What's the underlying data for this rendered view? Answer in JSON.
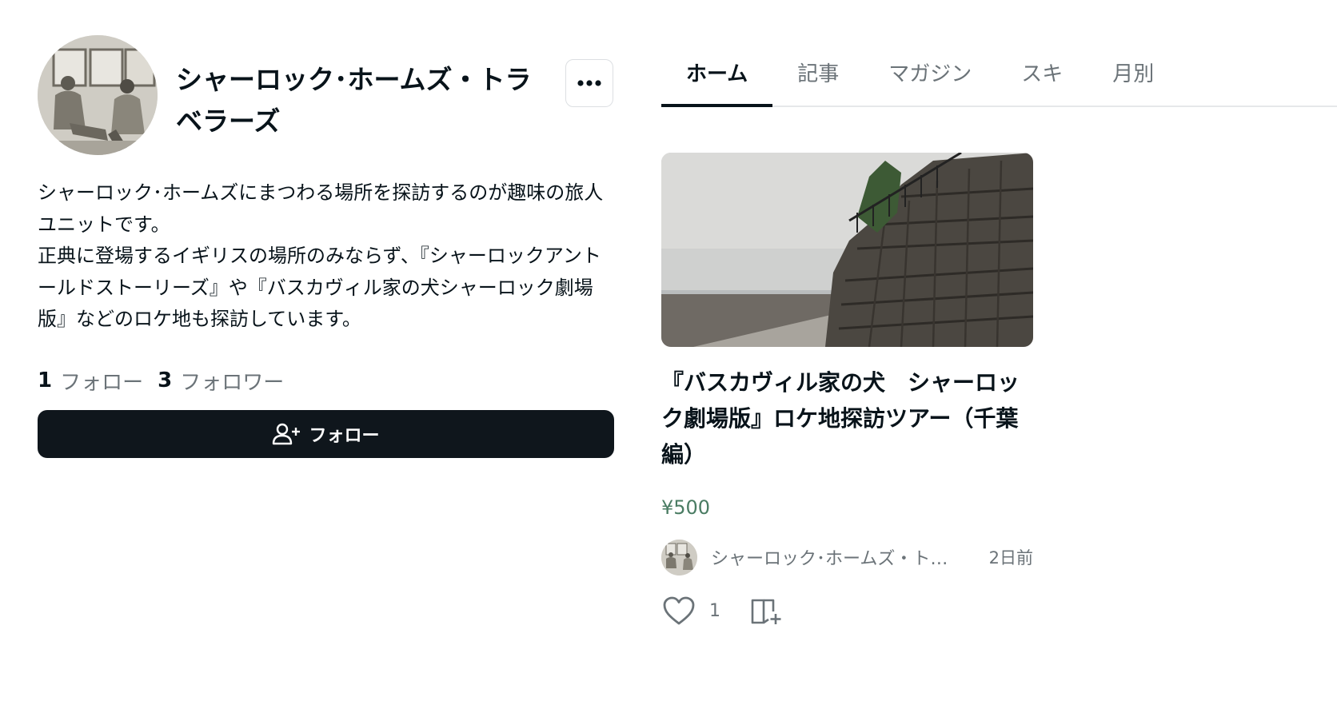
{
  "profile": {
    "name": "シャーロック･ホームズ・トラベラーズ",
    "bio": "シャーロック･ホームズにまつわる場所を探訪するのが趣味の旅人ユニットです。\n正典に登場するイギリスの場所のみならず、『シャーロックアントールドストーリーズ』や『バスカヴィル家の犬シャーロック劇場版』などのロケ地も探訪しています。",
    "following_count": "1",
    "following_label": "フォロー",
    "followers_count": "3",
    "followers_label": "フォロワー",
    "follow_button_label": "フォロー",
    "more_icon": "ellipsis-icon",
    "follow_icon": "user-plus-icon"
  },
  "tabs": [
    {
      "label": "ホーム",
      "active": true
    },
    {
      "label": "記事",
      "active": false
    },
    {
      "label": "マガジン",
      "active": false
    },
    {
      "label": "スキ",
      "active": false
    },
    {
      "label": "月別",
      "active": false
    }
  ],
  "article": {
    "title": "『バスカヴィル家の犬　シャーロック劇場版』ロケ地探訪ツアー（千葉編）",
    "price": "¥500",
    "author": "シャーロック･ホームズ・トラベラーズ",
    "time": "2日前",
    "like_count": "1",
    "like_icon": "heart-icon",
    "magazine_icon": "magazine-add-icon"
  },
  "colors": {
    "text": "#08131a",
    "muted": "#6b7378",
    "price": "#4a7c63",
    "button": "#0f161c",
    "border": "#e6e8ea"
  }
}
